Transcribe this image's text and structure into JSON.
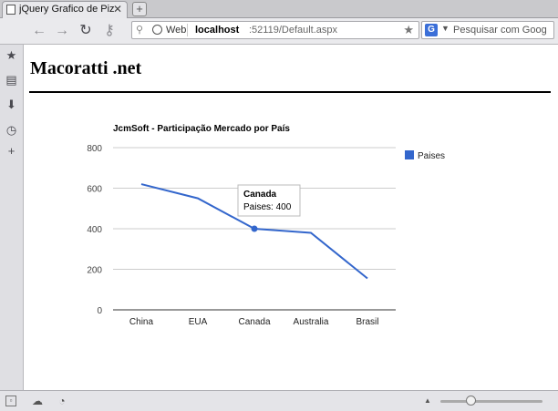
{
  "browser": {
    "tab_title": "jQuery Grafico de Pizza...",
    "tab_close": "✕",
    "new_tab": "+",
    "url_mode": "Web",
    "url_host": "localhost",
    "url_path": ":52119/Default.aspx",
    "search_engine": "G",
    "search_placeholder": "Pesquisar com Goog"
  },
  "page": {
    "site_title": "Macoratti .net"
  },
  "chart_data": {
    "type": "line",
    "title": "JcmSoft - Participação Mercado por País",
    "categories": [
      "China",
      "EUA",
      "Canada",
      "Australia",
      "Brasil"
    ],
    "series": [
      {
        "name": "Paises",
        "values": [
          620,
          550,
          400,
          380,
          155
        ],
        "color": "#3366cc"
      }
    ],
    "ylim": [
      0,
      800
    ],
    "yticks": [
      0,
      200,
      400,
      600,
      800
    ],
    "grid": true,
    "legend_position": "right",
    "tooltip": {
      "category": "Canada",
      "label": "Paises: 400"
    }
  }
}
